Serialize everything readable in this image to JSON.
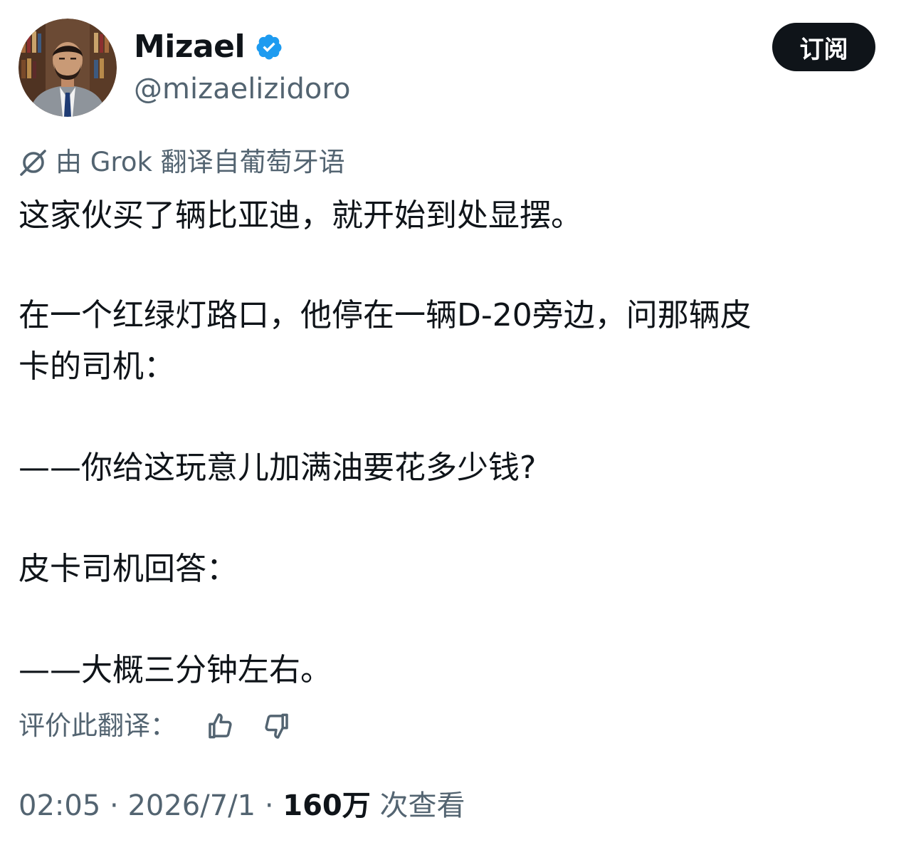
{
  "header": {
    "display_name": "Mizael",
    "handle": "@mizaelizidoro",
    "subscribe_label": "订阅",
    "avatar_icon": "profile-photo-man-in-suit",
    "verified_icon": "verified-badge-icon",
    "verified_color": "#1d9bf0"
  },
  "translation": {
    "icon": "grok-icon",
    "label": "由 Grok 翻译自葡萄牙语"
  },
  "tweet": {
    "lines": [
      "这家伙买了辆比亚迪，就开始到处显摆。",
      "在一个红绿灯路口，他停在一辆D-20旁边，问那辆皮",
      "卡的司机：",
      "——你给这玩意儿加满油要花多少钱?",
      "皮卡司机回答：",
      "——大概三分钟左右。"
    ]
  },
  "rating": {
    "label": "评价此翻译：",
    "like_icon": "thumbs-up-icon",
    "dislike_icon": "thumbs-down-icon"
  },
  "meta": {
    "time": "02:05",
    "date": "2026/7/1",
    "views_count": "160万",
    "views_label": "次查看",
    "separator": "·"
  },
  "colors": {
    "text_primary": "#0f1419",
    "text_secondary": "#536471",
    "button_bg": "#0f1419"
  }
}
